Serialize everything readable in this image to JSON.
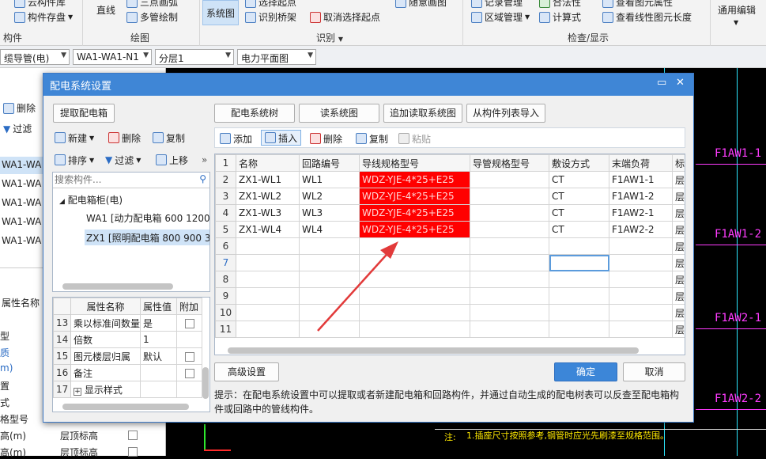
{
  "ribbon": {
    "items": {
      "component_library": "云构件库",
      "component_save": "构件存盘",
      "line": "直线",
      "three_point_arc": "三点画弧",
      "multi_pipe_draw": "多管绘制",
      "system_diagram": "系统图",
      "identify_bridge": "识别桥架",
      "select_start": "选择起点",
      "cancel_select_start": "取消选择起点",
      "follow_draw": "随意画图",
      "record_manage": "记录管理",
      "legal": "合法性",
      "region_manage": "区域管理",
      "calc_formula": "计算式",
      "view_element_attr": "查看图元属性",
      "view_line_length": "查看线性图元长度",
      "general_edit": "通用编辑"
    },
    "groups": {
      "component": "构件",
      "draw": "绘图",
      "identify": "识别",
      "check_display": "检查/显示"
    }
  },
  "toolbar2": {
    "combo1": "缆导管(电)",
    "combo2": "WA1-WA1-N1",
    "combo3": "分层1",
    "combo4": "电力平面图"
  },
  "left_bg": {
    "delete": "删除",
    "filter": "过滤",
    "rows": [
      "WA1-WA",
      "WA1-WA",
      "WA1-WA",
      "WA1-WA",
      "WA1-WA"
    ],
    "prop_header": "属性名称",
    "props": [
      "型",
      "质",
      "m)",
      "置",
      "式",
      "格型号",
      "高(m)",
      "高(m)"
    ],
    "prop_vals": [
      "层顶标高",
      "层顶标高"
    ]
  },
  "cad": {
    "labels": [
      "F1AW1-1",
      "F1AW1-2",
      "F1AW2-1",
      "F1AW2-2"
    ],
    "note": "1.插座尺寸按照参考,钢管时应光先刷漆至规格范围。",
    "note_prefix": "注:"
  },
  "dialog": {
    "title": "配电系统设置",
    "extract_button": "提取配电箱",
    "left_toolbar": {
      "new": "新建",
      "delete": "删除",
      "copy": "复制",
      "sort": "排序",
      "filter": "过滤",
      "move_up": "上移"
    },
    "search_placeholder": "搜索构件...",
    "tree": {
      "root": "配电箱柜(电)",
      "children": [
        "WA1 [动力配电箱 600 1200",
        "ZX1 [照明配电箱 800 900 30"
      ]
    },
    "props_header": [
      "属性名称",
      "属性值",
      "附加"
    ],
    "props": [
      {
        "no": "13",
        "name": "乘以标准间数量",
        "value": "是",
        "check": true
      },
      {
        "no": "14",
        "name": "倍数",
        "value": "1",
        "check": false
      },
      {
        "no": "15",
        "name": "图元楼层归属",
        "value": "默认",
        "check": true
      },
      {
        "no": "16",
        "name": "备注",
        "value": "",
        "check": true
      },
      {
        "no": "17",
        "name": "显示样式",
        "value": "",
        "check": false
      }
    ],
    "top_buttons": [
      "配电系统树",
      "读系统图",
      "追加读取系统图",
      "从构件列表导入"
    ],
    "grid_toolbar": {
      "add": "添加",
      "insert": "插入",
      "delete": "删除",
      "copy": "复制",
      "paste": "粘贴"
    },
    "grid": {
      "headers": [
        "名称",
        "回路编号",
        "导线规格型号",
        "导管规格型号",
        "敷设方式",
        "末端负荷",
        "标"
      ],
      "rows": [
        [
          "ZX1-WL1",
          "WL1",
          "WDZ-YJE-4*25+E25",
          "",
          "CT",
          "F1AW1-1",
          "层"
        ],
        [
          "ZX1-WL2",
          "WL2",
          "WDZ-YJE-4*25+E25",
          "",
          "CT",
          "F1AW1-2",
          "层"
        ],
        [
          "ZX1-WL3",
          "WL3",
          "WDZ-YJE-4*25+E25",
          "",
          "CT",
          "F1AW2-1",
          "层"
        ],
        [
          "ZX1-WL4",
          "WL4",
          "WDZ-YJE-4*25+E25",
          "",
          "CT",
          "F1AW2-2",
          "层"
        ],
        [
          "",
          "",
          "",
          "",
          "",
          "",
          "层"
        ],
        [
          "",
          "",
          "",
          "",
          "",
          "",
          "层"
        ],
        [
          "",
          "",
          "",
          "",
          "",
          "",
          "层"
        ],
        [
          "",
          "",
          "",
          "",
          "",
          "",
          "层"
        ],
        [
          "",
          "",
          "",
          "",
          "",
          "",
          "层"
        ],
        [
          "",
          "",
          "",
          "",
          "",
          "",
          "层"
        ]
      ]
    },
    "advanced_button": "高级设置",
    "ok_button": "确定",
    "cancel_button": "取消",
    "hint": "提示：在配电系统设置中可以提取或者新建配电箱和回路构件，并通过自动生成的配电树表可以反查至配电箱构件或回路中的管线构件。"
  },
  "colors": {
    "highlight_red": "#ff0000",
    "title_blue": "#3f86d6",
    "cad_magenta": "#ff3cff",
    "annotation_arrow": "#e23a3a"
  }
}
